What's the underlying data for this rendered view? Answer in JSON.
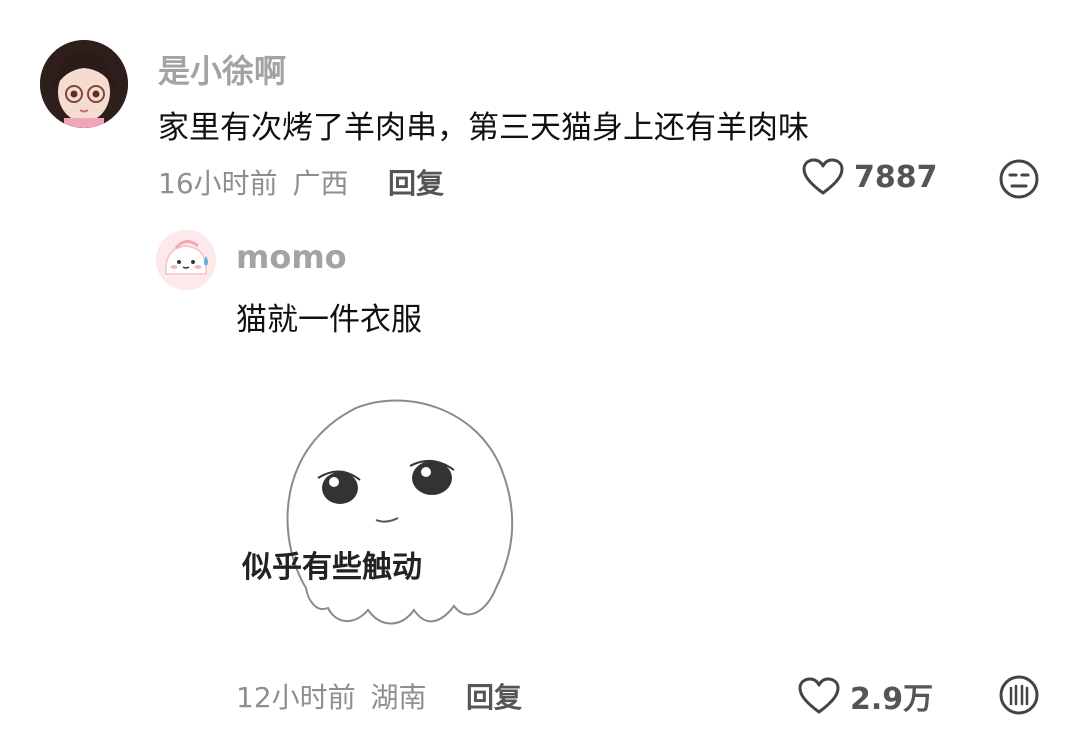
{
  "comment": {
    "username": "是小徐啊",
    "text": "家里有次烤了羊肉串，第三天猫身上还有羊肉味",
    "time": "16小时前",
    "location": "广西",
    "reply_label": "回复",
    "likes": "7887",
    "avatar_icon": "girl-with-glasses-avatar",
    "dislike_icon": "face-dislike-icon"
  },
  "reply": {
    "username": "momo",
    "text": "猫就一件衣服",
    "sticker": {
      "caption": "似乎有些触动",
      "icon": "ghost-sticker"
    },
    "time": "12小时前",
    "location": "湖南",
    "reply_label": "回复",
    "likes": "2.9万",
    "avatar_icon": "pink-blob-sweat-avatar",
    "dislike_icon": "face-dislike-icon"
  }
}
